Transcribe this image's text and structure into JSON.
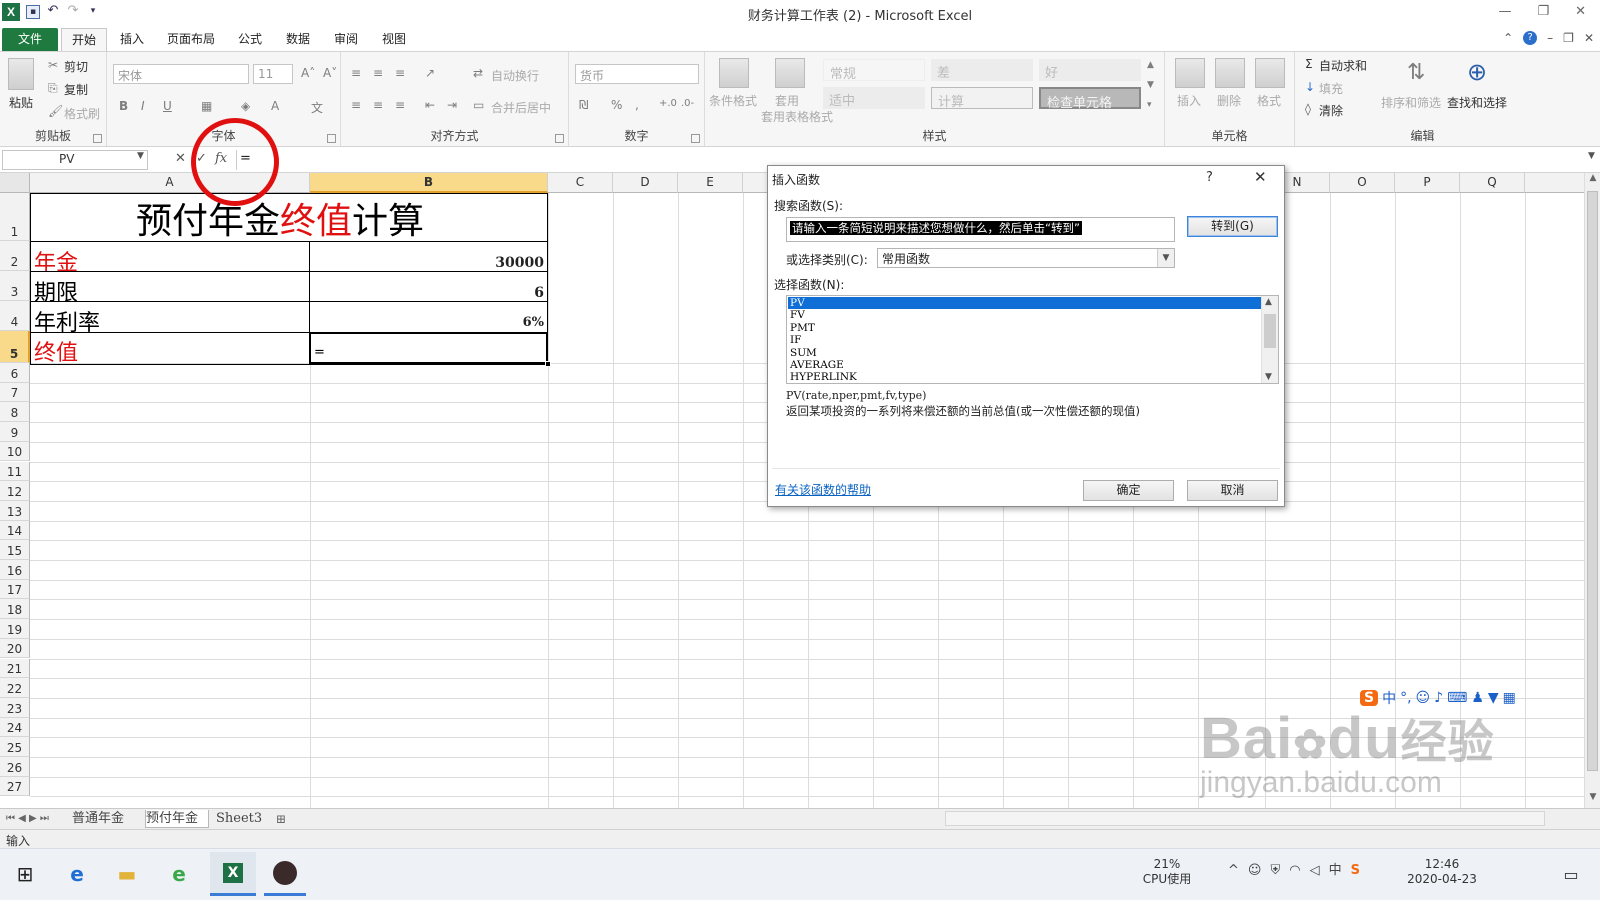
{
  "window": {
    "title": "财务计算工作表 (2) - Microsoft Excel"
  },
  "ribbon_tabs": [
    "文件",
    "开始",
    "插入",
    "页面布局",
    "公式",
    "数据",
    "审阅",
    "视图"
  ],
  "clipboard": {
    "paste": "粘贴",
    "cut": "剪切",
    "copy": "复制",
    "format_painter": "格式刷",
    "label": "剪贴板"
  },
  "font": {
    "name": "宋体",
    "size": "11",
    "label": "字体"
  },
  "alignment": {
    "wrap": "自动换行",
    "merge": "合并后居中",
    "label": "对齐方式"
  },
  "number": {
    "format": "货币",
    "label": "数字"
  },
  "styles": {
    "conditional": "条件格式",
    "table_format": "套用表格格式",
    "cells": [
      "常规",
      "差",
      "好",
      "适中",
      "计算",
      "检查单元格"
    ],
    "label": "样式"
  },
  "cells_group": {
    "insert": "插入",
    "delete": "删除",
    "format": "格式",
    "label": "单元格"
  },
  "editing": {
    "autosum": "自动求和",
    "fill": "填充",
    "clear": "清除",
    "sort": "排序和筛选",
    "find": "查找和选择",
    "label": "编辑"
  },
  "formula_bar": {
    "name_box": "PV",
    "formula": "=",
    "fx": "fx"
  },
  "columns": [
    "A",
    "B",
    "C",
    "D",
    "E",
    "N",
    "O",
    "P",
    "Q"
  ],
  "rows": [
    "1",
    "2",
    "3",
    "4",
    "5",
    "6",
    "7",
    "8",
    "9",
    "10",
    "11",
    "12",
    "13",
    "14",
    "15",
    "16",
    "17",
    "18",
    "19",
    "20",
    "21",
    "22",
    "23",
    "24",
    "25",
    "26",
    "27"
  ],
  "sheet": {
    "title_part1": "预付年金",
    "title_part2": "终值",
    "title_part3": "计算",
    "label_annuity": "年金",
    "value_annuity": "30000",
    "label_periods": "期限",
    "value_periods": "6",
    "label_rate": "年利率",
    "value_rate": "6%",
    "label_fv": "终值",
    "value_fv": "="
  },
  "sheet_tabs": [
    "普通年金",
    "预付年金",
    "Sheet3"
  ],
  "status": {
    "mode": "输入"
  },
  "dialog": {
    "title": "插入函数",
    "help": "?",
    "search_label": "搜索函数(S):",
    "search_text": "请输入一条简短说明来描述您想做什么，然后单击“转到”",
    "goto": "转到(G)",
    "category_label": "或选择类别(C):",
    "category_value": "常用函数",
    "select_label": "选择函数(N):",
    "functions": [
      "PV",
      "FV",
      "PMT",
      "IF",
      "SUM",
      "AVERAGE",
      "HYPERLINK"
    ],
    "signature": "PV(rate,nper,pmt,fv,type)",
    "description": "返回某项投资的一系列将来偿还额的当前总值(或一次性偿还额的现值)",
    "help_link": "有关该函数的帮助",
    "ok": "确定",
    "cancel": "取消"
  },
  "taskbar": {
    "cpu_percent": "21%",
    "cpu_label": "CPU使用",
    "time": "12:46",
    "date": "2020-04-23",
    "ime_lang": "中"
  },
  "watermark": {
    "brand": "Bai",
    "brand2": "du",
    "brand_cn": "经验",
    "url": "jingyan.baidu.com"
  },
  "colors": {
    "excel_green": "#1f7a3f",
    "red_text": "#e01010",
    "selection_blue": "#0f6fd6",
    "header_selected": "#f9d98a"
  }
}
